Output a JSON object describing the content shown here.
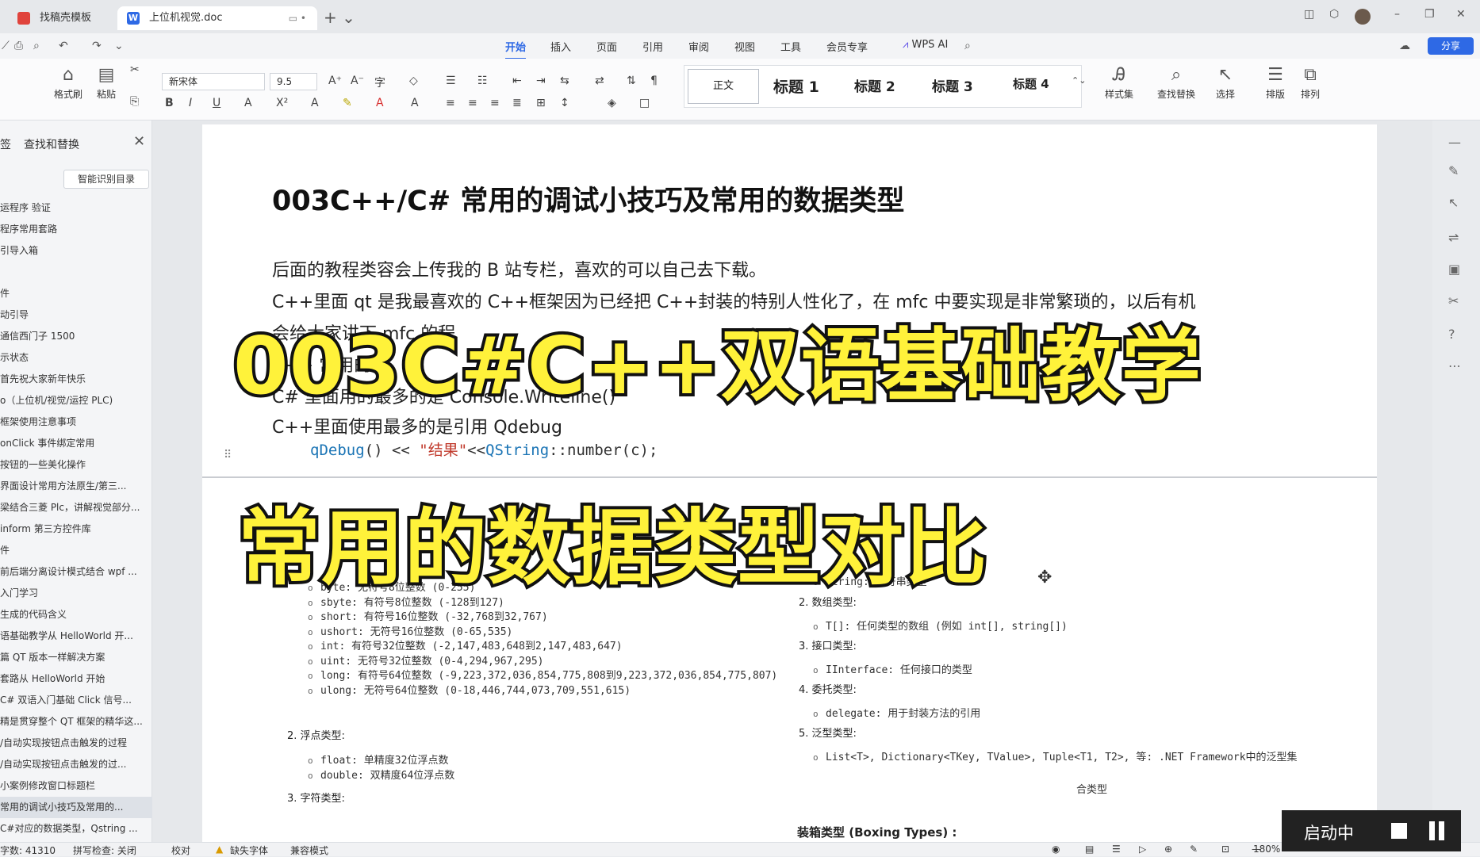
{
  "tabs": [
    {
      "label": "找稿壳模板",
      "icon": "wps-red-icon"
    },
    {
      "label": "上位机视觉.doc",
      "icon": "word-icon",
      "badge": "W"
    }
  ],
  "menu": [
    "开始",
    "插入",
    "页面",
    "引用",
    "审阅",
    "视图",
    "工具",
    "会员专享"
  ],
  "wps_ai": "WPS AI",
  "share_label": "分享",
  "ribbon": {
    "format_painter": "格式刷",
    "paste": "粘贴",
    "font_name": "新宋体",
    "font_size": "9.5",
    "styles": [
      "正文",
      "标题 1",
      "标题 2",
      "标题 3",
      "标题 4"
    ],
    "style_set": "样式集",
    "find_replace": "查找替换",
    "select": "选择",
    "layout": "排版",
    "arrange": "排列"
  },
  "sidebar": {
    "tab": "签",
    "title": "查找和替换",
    "smart_btn": "智能识别目录",
    "items": [
      "运程序 验证",
      "程序常用套路",
      "引导入箱",
      "",
      "件",
      "动引导",
      "通信西门子 1500",
      "示状态",
      "首先祝大家新年快乐",
      "o（上位机/视觉/运控 PLC)",
      "框架使用注意事项",
      "onClick 事件绑定常用",
      "按钮的一些美化操作",
      "界面设计常用方法原生/第三...",
      "梁结合三菱 Plc，讲解视觉部分...",
      "inform 第三方控件库",
      "件",
      "前后端分离设计模式结合 wpf ...",
      "入门学习",
      "生成的代码含义",
      "语基础教学从 HelloWorld 开...",
      "篇 QT 版本一样解决方案",
      "套路从 HelloWorld 开始",
      "C# 双语入门基础 Click 信号...",
      "精是贯穿整个 QT 框架的精华这...",
      "/自动实现按钮点击触发的过程",
      "/自动实现按钮点击触发的过...",
      "小案例修改窗口标题栏",
      "常用的调试小技巧及常用的...",
      "C#对应的数据类型，Qstring ..."
    ],
    "selected_index": 28
  },
  "doc": {
    "title": "003C++/C#  常用的调试小技巧及常用的数据类型",
    "lines": [
      "后面的教程类容会上传我的 B 站专栏，喜欢的可以自己去下载。",
      "C++里面 qt 是我最喜欢的 C++框架因为已经把 C++封装的特别人性化了，在 mfc 中要实现是非常繁琐的，以后有机",
      "会给大家讲下 mfc 的程",
      "C++  常用的断",
      "C#  里面用的最多的是 Console.Writeline()",
      "C++里面使用最多的是引用 Qdebug"
    ],
    "code": {
      "fn": "qDebug",
      "str": "\"结果\"",
      "cls": "QString",
      "rest": "::number(c);"
    }
  },
  "overlay": {
    "line1": "003C#C++双语基础教学",
    "line2": "常用的数据类型对比"
  },
  "datatypes": {
    "left_bullets": [
      "byte: 无符号8位整数 (0-255)",
      "sbyte: 有符号8位整数 (-128到127)",
      "short: 有符号16位整数 (-32,768到32,767)",
      "ushort: 无符号16位整数 (0-65,535)",
      "int: 有符号32位整数 (-2,147,483,648到2,147,483,647)",
      "uint: 无符号32位整数 (0-4,294,967,295)",
      "long: 有符号64位整数 (-9,223,372,036,854,775,808到9,223,372,036,854,775,807)",
      "ulong: 无符号64位整数 (0-18,446,744,073,709,551,615)"
    ],
    "float_heading": "2. 浮点类型:",
    "float_bullets": [
      "float: 单精度32位浮点数",
      "double: 双精度64位浮点数"
    ],
    "char_heading": "3. 字符类型:",
    "right": [
      {
        "heading": "",
        "bullet": "string: 字符串类型"
      },
      {
        "heading": "2. 数组类型:",
        "bullet": "T[]: 任何类型的数组 (例如 int[], string[])"
      },
      {
        "heading": "3. 接口类型:",
        "bullet": "IInterface: 任何接口的类型"
      },
      {
        "heading": "4. 委托类型:",
        "bullet": "delegate: 用于封装方法的引用"
      },
      {
        "heading": "5. 泛型类型:",
        "bullet": "List<T>, Dictionary<TKey, TValue>, Tuple<T1, T2>, 等: .NET Framework中的泛型集"
      }
    ],
    "generic_cont": "合类型",
    "boxing": "装箱类型 (Boxing Types) :"
  },
  "status": {
    "word_count": "字数: 41310",
    "spell": "拼写检查: 关闭",
    "proof": "校对",
    "missing_font": "缺失字体",
    "compat": "兼容模式",
    "zoom": "180%"
  },
  "recorder": {
    "label": "启动中"
  }
}
